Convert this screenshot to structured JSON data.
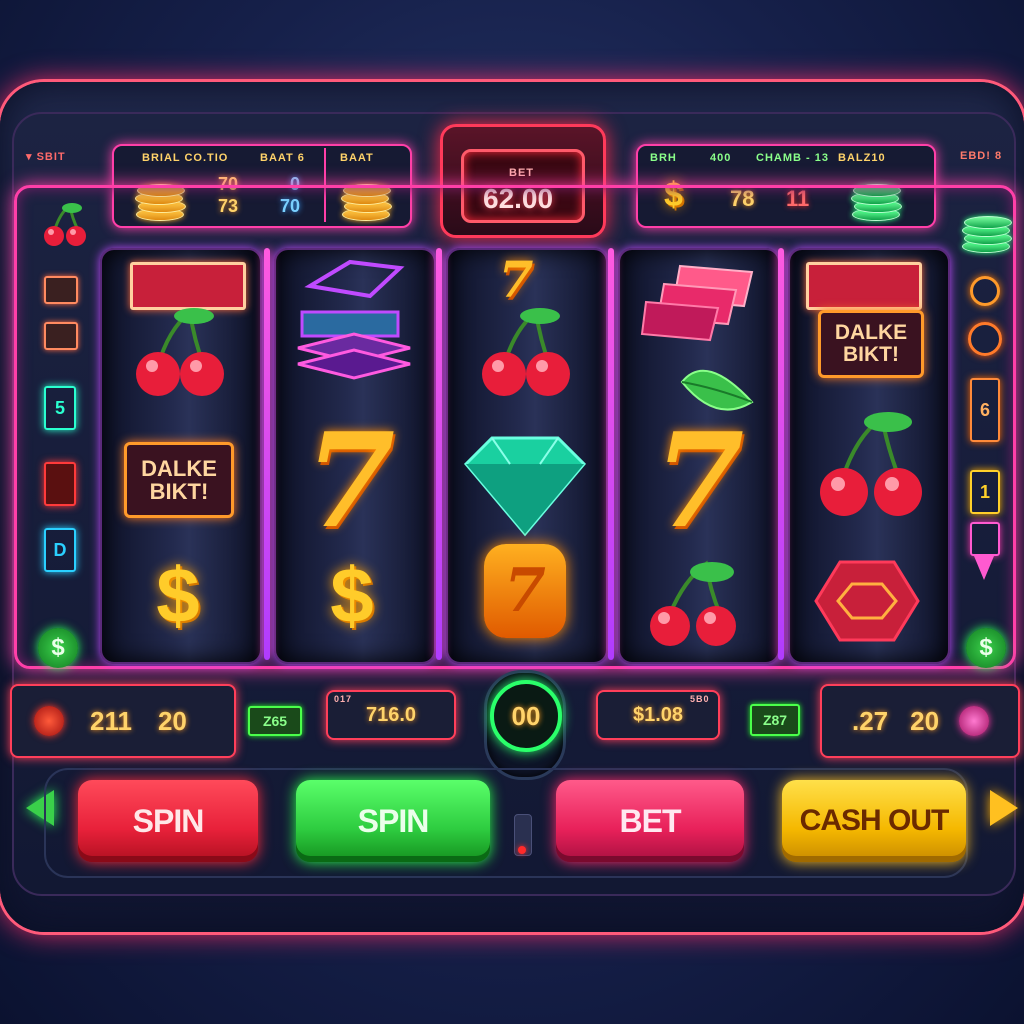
{
  "header": {
    "top_left_label": "▾ SBIT",
    "top_right_label": "EBD! 8",
    "left_panel": {
      "label_1": "BRIAL CO.TIO",
      "label_2": "BAAT 6",
      "label_3": "BAAT",
      "value_1": "70",
      "value_2": "73",
      "value_3": "0",
      "value_4": "70"
    },
    "center_display": {
      "label": "BET",
      "value": "62.00"
    },
    "right_panel": {
      "label_1": "BRH",
      "label_2": "400",
      "label_3": "CHAMB - 13",
      "label_4": "BALZ10",
      "value_1": "78",
      "value_2": "11"
    }
  },
  "reels": [
    {
      "symbols": [
        "banner",
        "cherry",
        "sign",
        "dollar"
      ]
    },
    {
      "symbols": [
        "gem-outline",
        "gem-stack",
        "seven",
        "dollar"
      ]
    },
    {
      "symbols": [
        "seven-small",
        "cherry",
        "diamond",
        "seven-badge"
      ]
    },
    {
      "symbols": [
        "ticket-stack",
        "leaf",
        "seven",
        "cherry"
      ]
    },
    {
      "symbols": [
        "banner",
        "sign",
        "cherry",
        "hexagon"
      ]
    }
  ],
  "sign_text": {
    "line_1": "DALKE",
    "line_2": "BIKT!"
  },
  "symbol_text": {
    "seven": "7",
    "dollar": "$",
    "left_sign_box_1": "5",
    "left_sign_box_2": "D",
    "right_sign_box_1": "6",
    "right_sign_box_2": "1"
  },
  "meters": {
    "left": {
      "value_a": "211",
      "value_b": "20"
    },
    "left_small": "Z65",
    "center_left": {
      "label": "017",
      "value": "716.0"
    },
    "center_dial": "00",
    "center_right": {
      "label": "5B0",
      "value": "$1.08"
    },
    "right_small": "Z87",
    "right": {
      "value_a": ".27",
      "value_b": "20"
    }
  },
  "buttons": {
    "spin_red": "SPIN",
    "spin_green": "SPIN",
    "bet": "BET",
    "cash_out": "CASH OUT"
  },
  "colors": {
    "accent_pink": "#ff3fa8",
    "spin_red": "#e8213a",
    "spin_green": "#2ecc40",
    "bet": "#e8215a",
    "cash_out": "#f5b800"
  }
}
